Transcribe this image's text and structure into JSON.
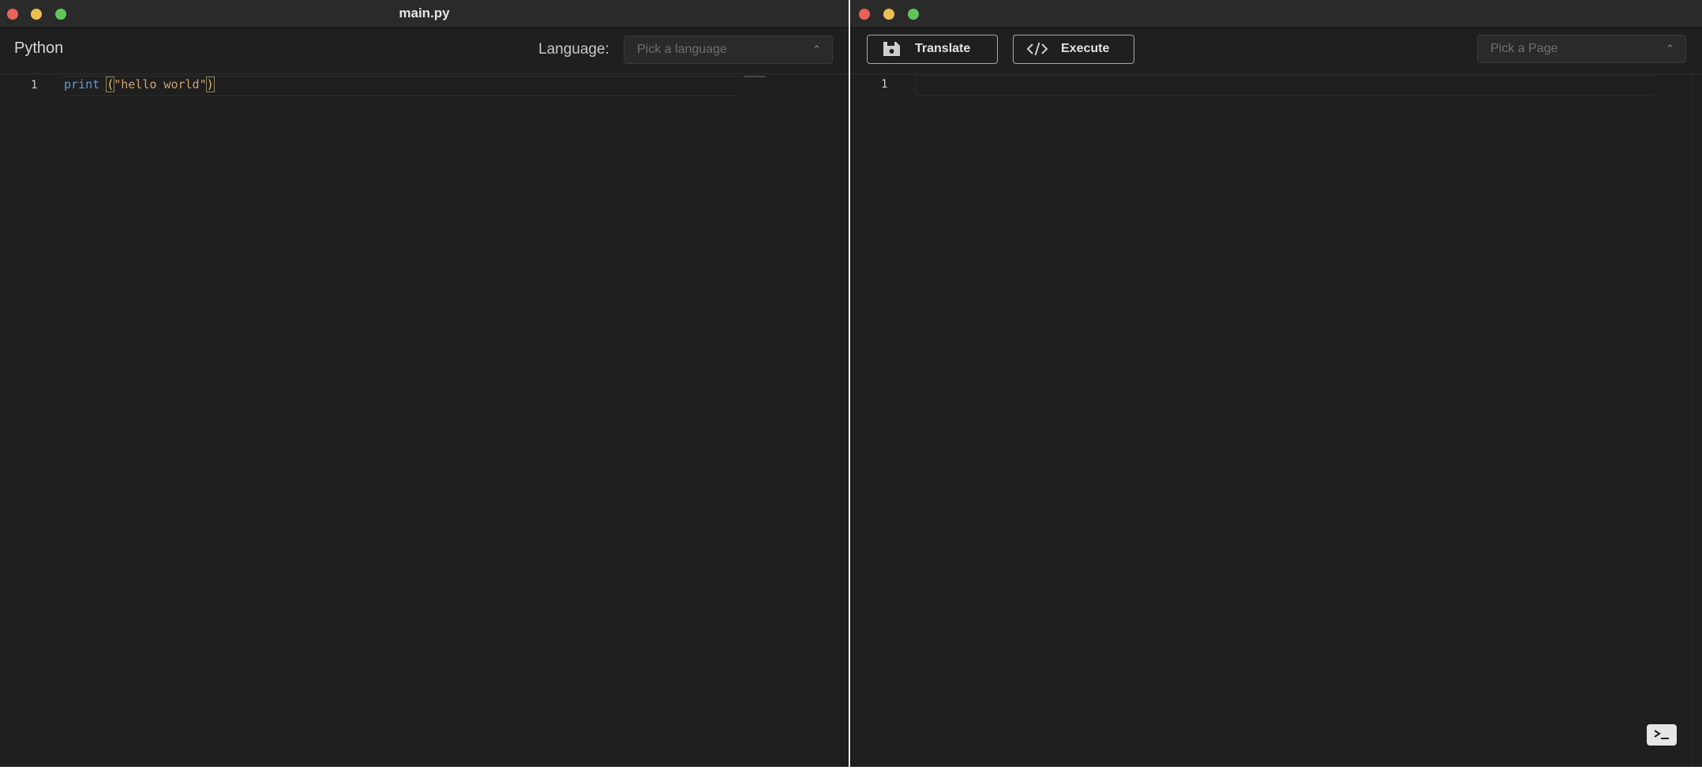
{
  "left_window": {
    "title": "main.py",
    "language_name": "Python",
    "language_label": "Language:",
    "language_select": {
      "placeholder": "Pick a language"
    },
    "editor": {
      "lines": [
        {
          "number": "1",
          "tokens": {
            "keyword": "print",
            "space": " ",
            "open_paren": "(",
            "string": "\"hello world\"",
            "close_paren": ")"
          }
        }
      ]
    }
  },
  "right_window": {
    "toolbar": {
      "translate_label": "Translate",
      "execute_label": "Execute",
      "translate_icon": "save-icon",
      "execute_icon": "code-icon"
    },
    "page_select": {
      "placeholder": "Pick a Page"
    },
    "editor": {
      "lines": [
        {
          "number": "1",
          "text": ""
        }
      ]
    },
    "terminal_icon": "terminal-icon"
  },
  "colors": {
    "window_bg": "#1f1f1f",
    "titlebar_bg": "#2a2a2a",
    "keyword": "#5c9fd6",
    "string": "#d1a26e",
    "bracket": "#e1c25c",
    "close": "#e9625a",
    "minimize": "#e9bf52",
    "maximize": "#5fc55a"
  }
}
